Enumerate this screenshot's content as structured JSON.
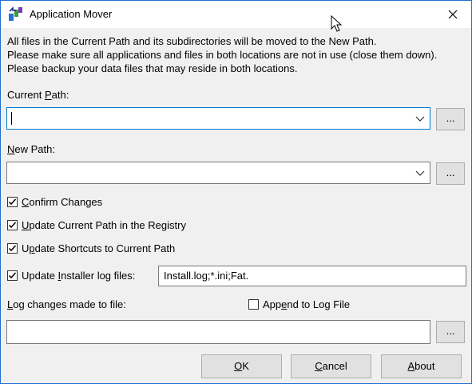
{
  "window": {
    "title": "Application Mover",
    "icons": {
      "app": "app-mover-icon",
      "close": "close-icon",
      "cursor": "mouse-pointer-icon"
    }
  },
  "info": {
    "line1": "All files in the Current Path and its subdirectories will be moved to the New Path.",
    "line2": "Please make sure all applications and files in both locations are not in use (close them down).",
    "line3": "Please backup your data files that may reside in both locations."
  },
  "current_path": {
    "label_pre": "Current ",
    "label_key": "P",
    "label_post": "ath:",
    "value": "",
    "browse": "..."
  },
  "new_path": {
    "label_key": "N",
    "label_post": "ew Path:",
    "value": "",
    "browse": "..."
  },
  "options": {
    "confirm": {
      "key": "C",
      "rest": "onfirm Changes",
      "checked": true
    },
    "registry": {
      "key": "U",
      "rest": "pdate Current Path in the Registry",
      "checked": true
    },
    "shortcuts": {
      "pre": "U",
      "key": "p",
      "rest": "date Shortcuts to Current Path",
      "checked": true
    },
    "installer": {
      "pre": "Update ",
      "key": "I",
      "rest": "nstaller log files:",
      "checked": true,
      "value": "Install.log;*.ini;Fat."
    }
  },
  "log": {
    "label_key": "L",
    "label_post": "og changes made to file:",
    "append": {
      "pre": "App",
      "key": "e",
      "rest": "nd to Log File",
      "checked": false
    },
    "value": "",
    "browse": "..."
  },
  "buttons": {
    "ok": {
      "key": "O",
      "rest": "K"
    },
    "cancel": {
      "key": "C",
      "rest": "ancel"
    },
    "about": {
      "key": "A",
      "rest": "bout"
    }
  }
}
